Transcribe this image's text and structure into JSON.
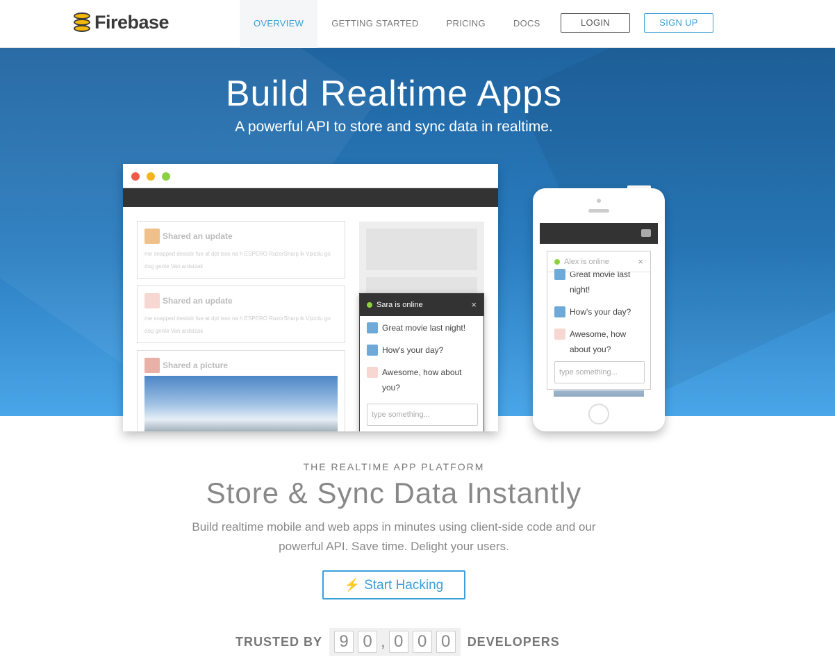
{
  "header": {
    "brand": "Firebase",
    "nav": [
      {
        "label": "OVERVIEW",
        "active": true
      },
      {
        "label": "GETTING STARTED",
        "active": false
      },
      {
        "label": "PRICING",
        "active": false
      },
      {
        "label": "DOCS",
        "active": false
      }
    ],
    "login_label": "LOGIN",
    "signup_label": "SIGN UP"
  },
  "hero": {
    "title": "Build Realtime Apps",
    "subtitle": "A powerful API to store and sync data in realtime."
  },
  "browser_demo": {
    "cards": [
      {
        "title": "Shared an update",
        "text": "me snapped desistir fue at dpt isso na h ESPERO RazorSharp ik Vpizdu go dog gente Van ardatzak"
      },
      {
        "title": "Shared an update",
        "text": "me snapped desistir fue at dpt isso na h ESPERO RazorSharp ik Vpizdu go dog gente Van ardatzak"
      },
      {
        "title": "Shared a picture",
        "text": ""
      }
    ],
    "chat": {
      "status": "Sara is online",
      "close": "×",
      "messages": [
        "Great movie last night!",
        "How's your day?",
        "Awesome, how about you?"
      ],
      "input_placeholder": "type something..."
    }
  },
  "phone_demo": {
    "chat": {
      "status": "Alex is online",
      "close": "×",
      "messages": [
        "Great movie last night!",
        "How's your day?",
        "Awesome, how about you?"
      ],
      "input_placeholder": "type something..."
    }
  },
  "platform": {
    "eyebrow": "THE REALTIME APP PLATFORM",
    "headline": "Store & Sync Data Instantly",
    "lead": "Build realtime mobile and web apps in minutes using client-side code and our powerful API. Save time. Delight your users.",
    "cta_label": "Start Hacking",
    "cta_icon": "⚡"
  },
  "trusted": {
    "prefix": "TRUSTED BY",
    "digits": [
      "9",
      "0",
      "0",
      "0",
      "0"
    ],
    "separator": ",",
    "suffix": "DEVELOPERS"
  },
  "colors": {
    "accent": "#3b9fd8",
    "hero_top": "#1f64a0",
    "hero_bottom": "#4aa6e8",
    "logo_yellow": "#f5b90b",
    "online": "#8fd13b"
  }
}
